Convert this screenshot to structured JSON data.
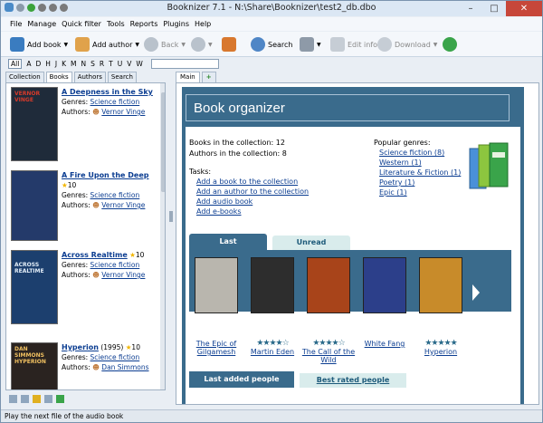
{
  "window": {
    "title": "Booknizer 7.1 - N:\\Share\\Booknizer\\test2_db.dbo",
    "minimize": "–",
    "maximize": "□",
    "close": "✕"
  },
  "menu": [
    "File",
    "Manage",
    "Quick filter",
    "Tools",
    "Reports",
    "Plugins",
    "Help"
  ],
  "toolbar": {
    "add_book": "Add book",
    "add_author": "Add author",
    "back": "Back",
    "search": "Search",
    "edit_info": "Edit info",
    "download": "Download"
  },
  "alphabet": [
    "All",
    "A",
    "D",
    "H",
    "J",
    "K",
    "M",
    "N",
    "S",
    "R",
    "T",
    "U",
    "V",
    "W"
  ],
  "left_tabs": [
    "Collection",
    "Books",
    "Authors",
    "Search"
  ],
  "books": [
    {
      "title": "A Deepness in the Sky",
      "rating": "",
      "year": "",
      "genre_label": "Genres:",
      "genre": "Science fiction",
      "author_label": "Authors:",
      "author": "Vernor Vinge",
      "cover_text": "VERNOR VINGE"
    },
    {
      "title": "A Fire Upon the Deep",
      "rating": "10",
      "year": "",
      "genre_label": "Genres:",
      "genre": "Science fiction",
      "author_label": "Authors:",
      "author": "Vernor Vinge",
      "cover_text": ""
    },
    {
      "title": "Across Realtime",
      "rating": "10",
      "year": "",
      "genre_label": "Genres:",
      "genre": "Science fiction",
      "author_label": "Authors:",
      "author": "Vernor Vinge",
      "cover_text": "ACROSS REALTIME"
    },
    {
      "title": "Hyperion",
      "rating": "10",
      "year": "(1995)",
      "genre_label": "Genres:",
      "genre": "Science fiction",
      "author_label": "Authors:",
      "author": "Dan Simmons",
      "cover_text": "DAN SIMMONS HYPERION"
    }
  ],
  "main_tabs": {
    "main": "Main",
    "add": "+"
  },
  "organizer": {
    "heading": "Book organizer",
    "books_count": "Books in the collection: 12",
    "authors_count": "Authors in the collection: 8",
    "tasks_label": "Tasks:",
    "tasks": [
      "Add a book to the collection",
      "Add an author to the collection",
      "Add audio book",
      "Add e-books"
    ],
    "popular_label": "Popular genres:",
    "popular": [
      "Science fiction (8)",
      "Western (1)",
      "Literature & Fiction (1)",
      "Poetry (1)",
      "Epic (1)"
    ],
    "tab_last": "Last",
    "tab_unread": "Unread",
    "tab_people": "Last added people",
    "tab_best": "Best rated people"
  },
  "recent": [
    {
      "title": "The Epic of Gilgamesh",
      "stars": "",
      "color": "#b9b6ae"
    },
    {
      "title": "Martin Eden",
      "stars": "★★★★☆",
      "color": "#2d2d2d"
    },
    {
      "title": "The Call of the Wild",
      "stars": "★★★★☆",
      "color": "#a8441a"
    },
    {
      "title": "White Fang",
      "stars": "",
      "color": "#2c3f8a"
    },
    {
      "title": "Hyperion",
      "stars": "★★★★★",
      "color": "#c88b2a"
    }
  ],
  "status": "Play the next file of the audio book"
}
